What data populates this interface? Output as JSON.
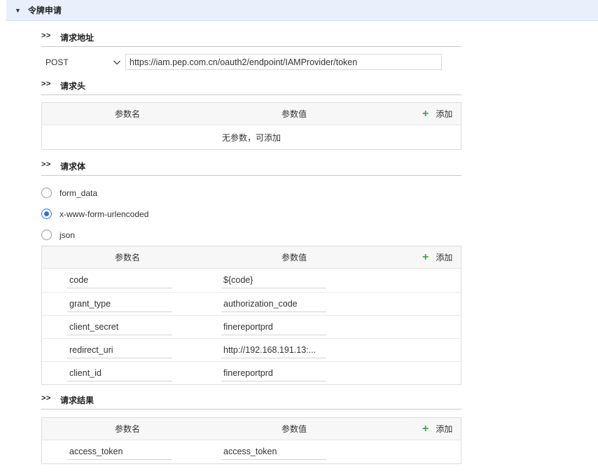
{
  "panel": {
    "title": "令牌申请"
  },
  "request_url": {
    "section_label": "请求地址",
    "method": "POST",
    "url": "https://iam.pep.com.cn/oauth2/endpoint/IAMProvider/token"
  },
  "headers": {
    "section_label": "请求头",
    "col_name": "参数名",
    "col_value": "参数值",
    "add_label": "添加",
    "empty_text": "无参数，可添加"
  },
  "body": {
    "section_label": "请求体",
    "options": [
      {
        "label": "form_data",
        "checked": false
      },
      {
        "label": "x-www-form-urlencoded",
        "checked": true
      },
      {
        "label": "json",
        "checked": false
      }
    ],
    "col_name": "参数名",
    "col_value": "参数值",
    "add_label": "添加",
    "rows": [
      {
        "name": "code",
        "value": "${code}"
      },
      {
        "name": "grant_type",
        "value": "authorization_code"
      },
      {
        "name": "client_secret",
        "value": "finereportprd"
      },
      {
        "name": "redirect_uri",
        "value": "http://192.168.191.13:..."
      },
      {
        "name": "client_id",
        "value": "finereportprd"
      }
    ]
  },
  "result": {
    "section_label": "请求结果",
    "col_name": "参数名",
    "col_value": "参数值",
    "add_label": "添加",
    "rows": [
      {
        "name": "access_token",
        "value": "access_token"
      }
    ]
  },
  "section_marker": ">>",
  "colors": {
    "accent": "#2f6fd6",
    "add_plus": "#3fa83f",
    "header_bg": "#e9f0fb"
  },
  "icons": {
    "caret": "caret-down-icon",
    "chevron": "chevron-down-icon",
    "add": "plus-icon"
  }
}
